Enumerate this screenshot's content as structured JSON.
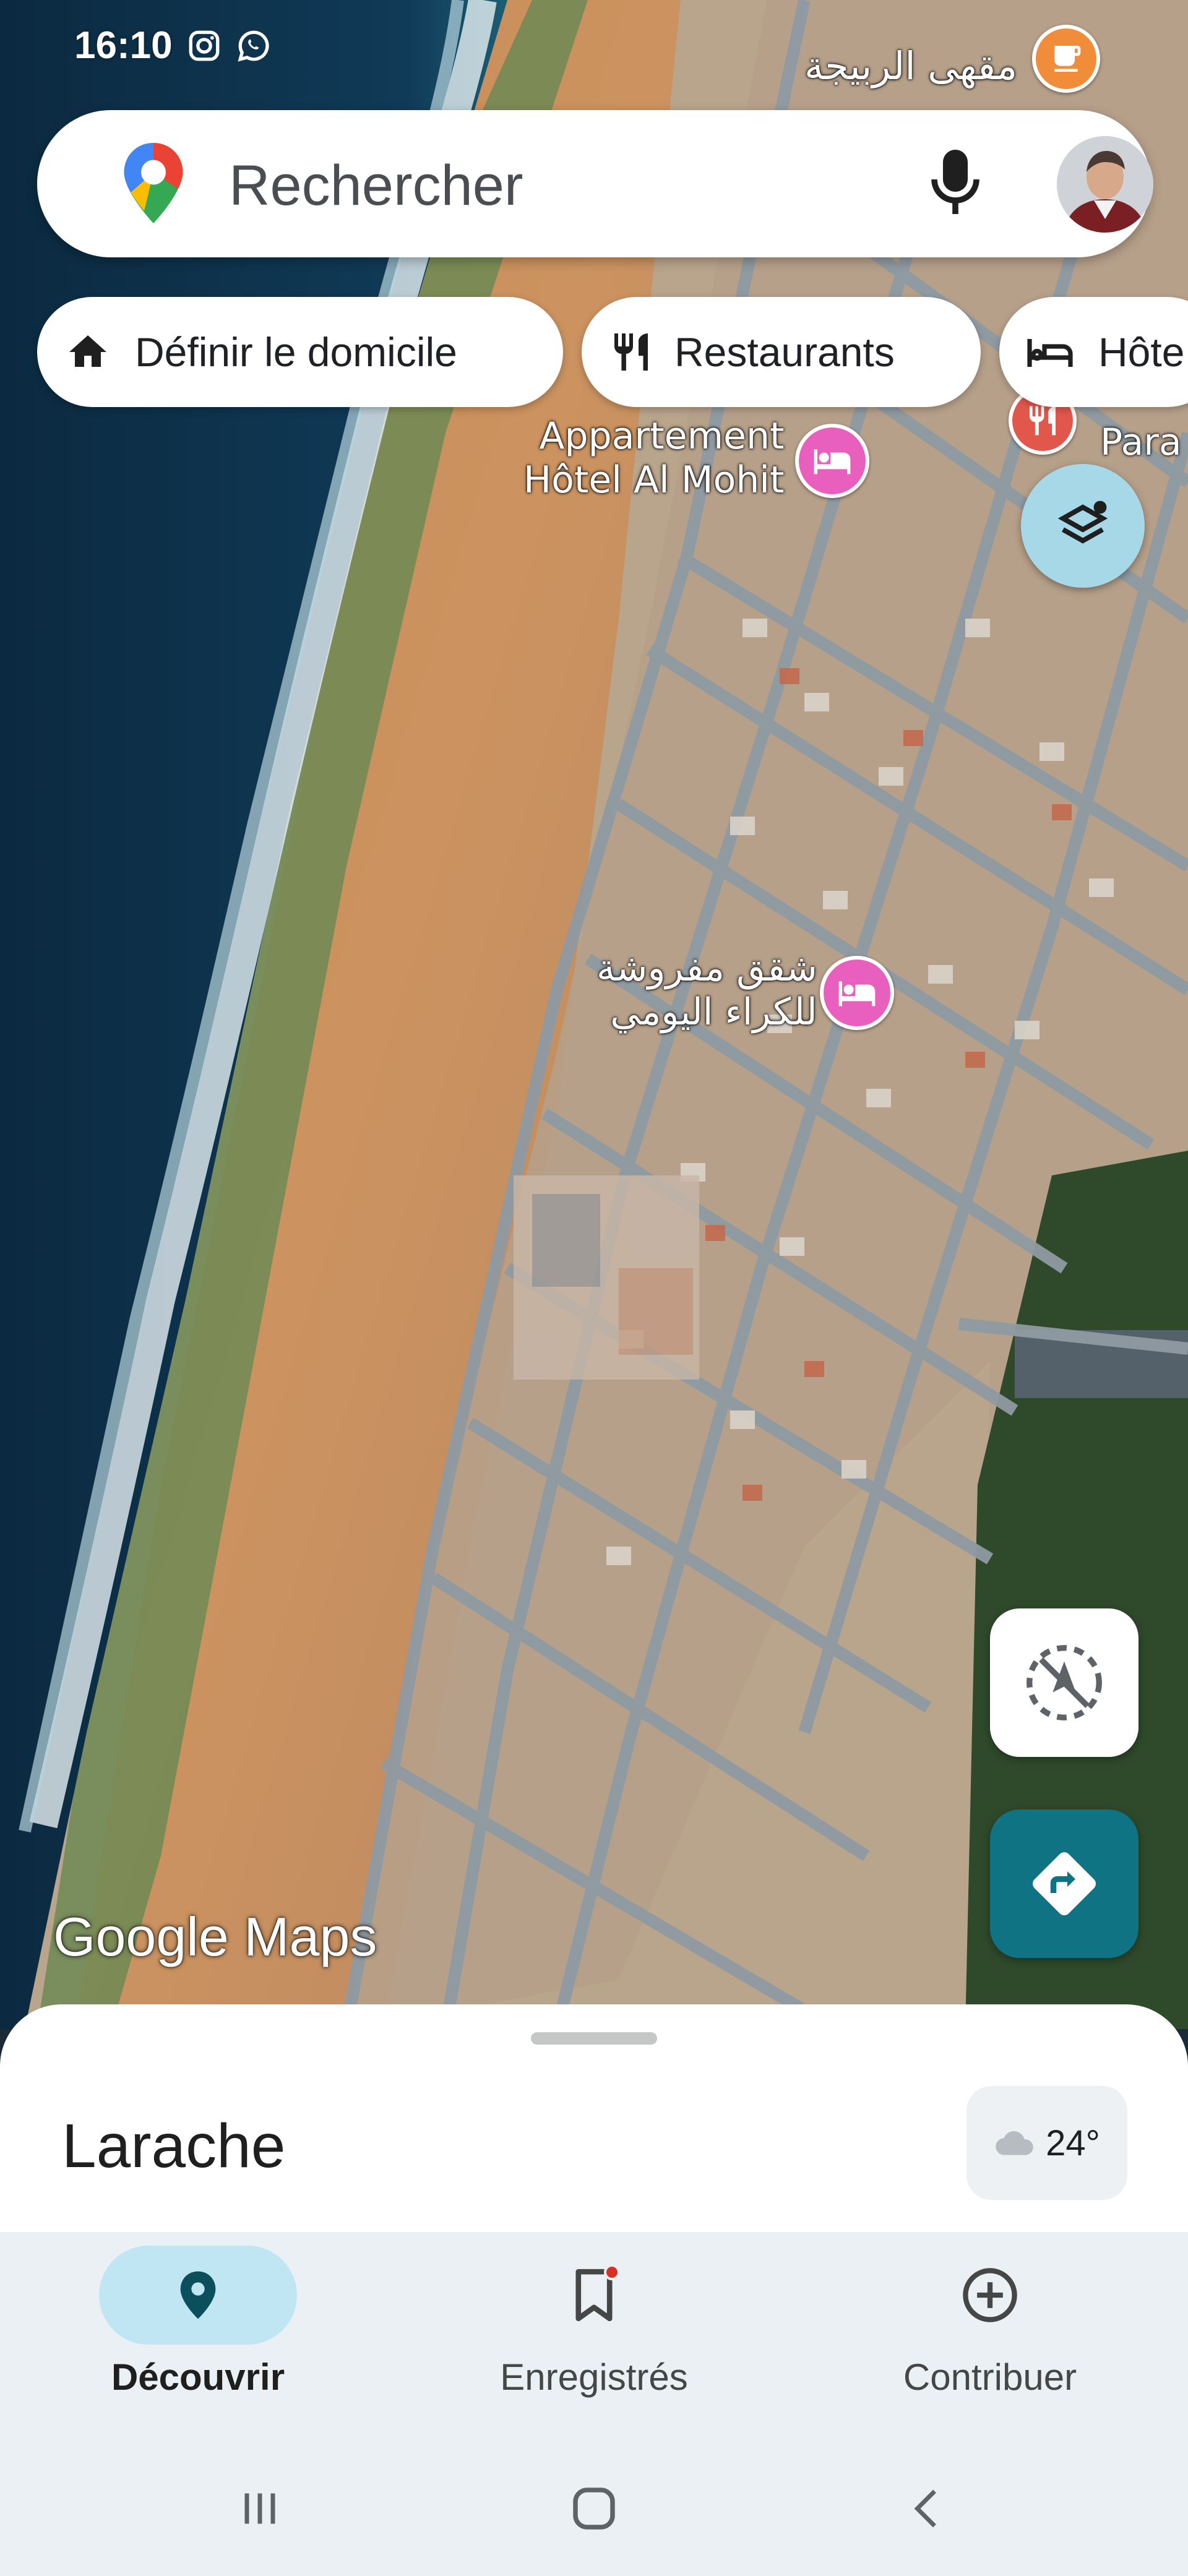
{
  "status_bar": {
    "time": "16:10",
    "icons": [
      "instagram-icon",
      "whatsapp-icon"
    ]
  },
  "search": {
    "placeholder": "Rechercher",
    "icons": [
      "maps-pin-logo",
      "mic-icon",
      "account-avatar"
    ]
  },
  "chips": [
    {
      "label": "Définir le domicile",
      "icon": "home-icon"
    },
    {
      "label": "Restaurants",
      "icon": "fork-knife-icon"
    },
    {
      "label": "Hôte",
      "icon": "bed-icon"
    }
  ],
  "map": {
    "labels": {
      "cafe": "مقهى الربيجة",
      "hotel": "Appartement\nHôtel Al Mohit",
      "apartments": "شقق مفروشة\nللكراء اليومي",
      "partial": "Para"
    },
    "attribution": "Google Maps",
    "colors": {
      "sea": "#0f3149",
      "sand": "#c98a55",
      "road": "#8f9aa3",
      "poi": "#e85fbd"
    }
  },
  "controls": {
    "layers": "layers-icon",
    "compass": "compass-icon",
    "directions": "directions-icon"
  },
  "sheet": {
    "place": "Larache",
    "weather": {
      "temp": "24°",
      "icon": "cloud-icon"
    }
  },
  "nav": {
    "items": [
      {
        "label": "Découvrir",
        "icon": "explore-pin-icon",
        "active": true
      },
      {
        "label": "Enregistrés",
        "icon": "bookmark-icon",
        "active": false
      },
      {
        "label": "Contribuer",
        "icon": "add-circle-icon",
        "active": false
      }
    ]
  },
  "system_nav": [
    "recents-icon",
    "home-icon",
    "back-icon"
  ]
}
